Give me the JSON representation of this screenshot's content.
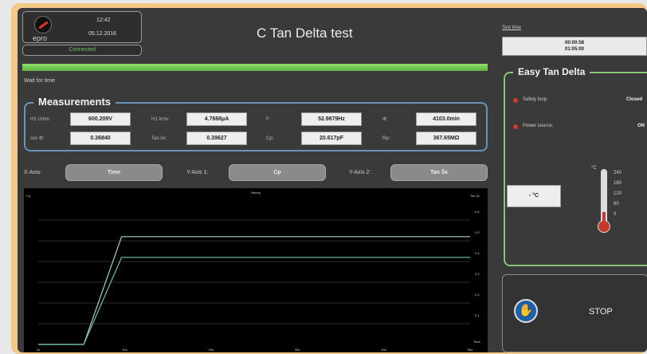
{
  "header": {
    "time": "12:42",
    "date": "05.12.2016",
    "brand": "epro",
    "connection": "Connected",
    "title": "C Tan Delta test"
  },
  "status": {
    "message": "Wait for time",
    "progress_percent": 100
  },
  "measurements": {
    "title": "Measurements",
    "rows": [
      [
        {
          "label": "H1 Urms:",
          "value": "600.209V"
        },
        {
          "label": "H1 Irms:",
          "value": "4.7668µA"
        },
        {
          "label": "F:",
          "value": "52.9879Hz"
        },
        {
          "label": "Φ:",
          "value": "4103.0min"
        }
      ],
      [
        {
          "label": "cos Φ:",
          "value": "0.36840"
        },
        {
          "label": "Tan δx:",
          "value": "0.39627"
        },
        {
          "label": "Cp:",
          "value": "20.617pF"
        },
        {
          "label": "Rp:",
          "value": "367.65MΩ"
        }
      ]
    ]
  },
  "axes": {
    "x_label": "X-Axis:",
    "x_value": "Time",
    "y1_label": "Y-Axis 1:",
    "y1_value": "Cp",
    "y2_label": "Y-Axis 2:",
    "y2_value": "Tan δx"
  },
  "chart_data": {
    "type": "line",
    "title": "History",
    "ylabel": "Cp",
    "y2label": "Tan δx",
    "xlabel": "Time",
    "x_ticks": [
      "0s",
      "10s",
      "20s",
      "30s",
      "40s",
      "50s"
    ],
    "y_ticks": [
      "",
      "",
      "",
      "",
      "",
      "",
      ""
    ],
    "y2_ticks": [
      "0.6",
      "0.5",
      "0.4",
      "0.3",
      "0.2",
      "0.1",
      ""
    ],
    "series": [
      {
        "values_x": [
          0,
          6,
          11,
          57
        ],
        "values_y": [
          0,
          0,
          5.2,
          5.2
        ]
      },
      {
        "values_x": [
          0,
          6,
          11,
          57
        ],
        "values_y": [
          0,
          0,
          4.2,
          4.2
        ]
      }
    ],
    "colors": {
      "line1": "#a0d8b8",
      "line2": "#6ec4a6",
      "grid": "#2b2b2b"
    }
  },
  "test_time": {
    "label": "Test time",
    "elapsed": "00:00:58",
    "total": "01:05:00"
  },
  "easy": {
    "title": "Easy Tan Delta",
    "safety_label": "Safety loop:",
    "safety_value": "Closed",
    "power_label": "Power source:",
    "power_value": "ON",
    "temp_value": "- °C",
    "temp_unit": "°C",
    "temp_scale": [
      "240",
      "180",
      "120",
      "60",
      "0"
    ]
  },
  "stop": {
    "label": "STOP"
  }
}
